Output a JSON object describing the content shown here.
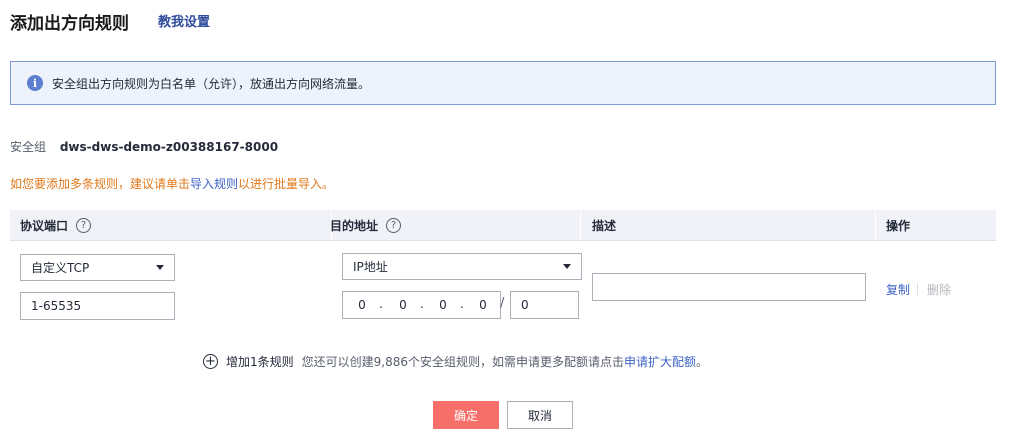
{
  "header": {
    "title": "添加出方向规则",
    "help_link": "教我设置"
  },
  "info_banner": {
    "icon": "info-icon",
    "text": "安全组出方向规则为白名单（允许），放通出方向网络流量。"
  },
  "security_group": {
    "label": "安全组",
    "name": "dws-dws-demo-z00388167-8000"
  },
  "tip": {
    "prefix": "如您要添加多条规则，建议请单击",
    "link": "导入规则",
    "suffix": "以进行批量导入。"
  },
  "table": {
    "columns": {
      "protocol_port": "协议端口",
      "destination": "目的地址",
      "description": "描述",
      "actions": "操作"
    },
    "help_glyph": "?",
    "row": {
      "protocol_select": "自定义TCP",
      "port_value": "1-65535",
      "address_type_select": "IP地址",
      "ip_octets": [
        "0",
        "0",
        "0",
        "0"
      ],
      "ip_dot": ".",
      "slash": "/",
      "mask_value": "0",
      "description_value": "",
      "copy_label": "复制",
      "delete_label": "删除"
    }
  },
  "add_rule": {
    "icon": "plus-circle-icon",
    "icon_glyph": "+",
    "label": "增加1条规则",
    "note_prefix": "您还可以创建9,886个安全组规则，如需申请更多配额请点击",
    "note_link": "申请扩大配额",
    "note_suffix": "。"
  },
  "footer": {
    "confirm_label": "确定",
    "cancel_label": "取消"
  },
  "colors": {
    "accent_link": "#3e63c4",
    "warning_text": "#e0781a",
    "primary_button": "#f66f6a",
    "info_border": "#7f9bd6",
    "info_bg": "#eef2fb"
  }
}
